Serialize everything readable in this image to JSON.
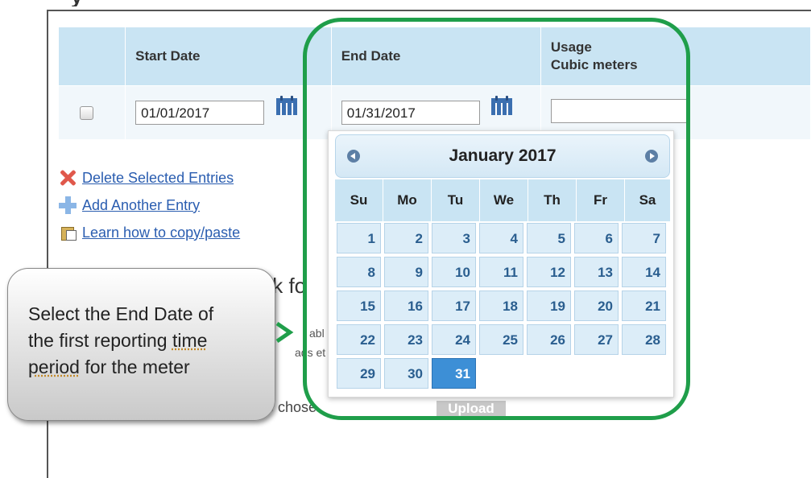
{
  "table": {
    "headers": {
      "start": "Start Date",
      "end": "End Date",
      "usage_line1": "Usage",
      "usage_line2": "Cubic meters"
    },
    "row": {
      "start_value": "01/01/2017",
      "end_value": "01/31/2017",
      "usage_value": ""
    }
  },
  "links": {
    "delete": "Delete Selected Entries",
    "add": "Add Another Entry",
    "learn": "Learn how to copy/paste"
  },
  "background_fragments": {
    "bulk": "ulk fo",
    "abl": "abl",
    "ads_et": "ads et",
    "chose": "e chose",
    "upload": "Upload"
  },
  "datepicker": {
    "title": "January 2017",
    "weekdays": [
      "Su",
      "Mo",
      "Tu",
      "We",
      "Th",
      "Fr",
      "Sa"
    ],
    "weeks": [
      [
        "1",
        "2",
        "3",
        "4",
        "5",
        "6",
        "7"
      ],
      [
        "8",
        "9",
        "10",
        "11",
        "12",
        "13",
        "14"
      ],
      [
        "15",
        "16",
        "17",
        "18",
        "19",
        "20",
        "21"
      ],
      [
        "22",
        "23",
        "24",
        "25",
        "26",
        "27",
        "28"
      ],
      [
        "29",
        "30",
        "31",
        "",
        "",
        "",
        ""
      ]
    ],
    "selected": "31"
  },
  "callout": {
    "line1": "Select the End Date of",
    "line2a": "the first reporting ",
    "line2b": "time",
    "line3a": "period",
    "line3b": " for the meter"
  },
  "colors": {
    "highlight": "#1f9e4a",
    "header_bg": "#c9e4f3",
    "link": "#2a5db0",
    "selected_day": "#3d8fd6"
  }
}
